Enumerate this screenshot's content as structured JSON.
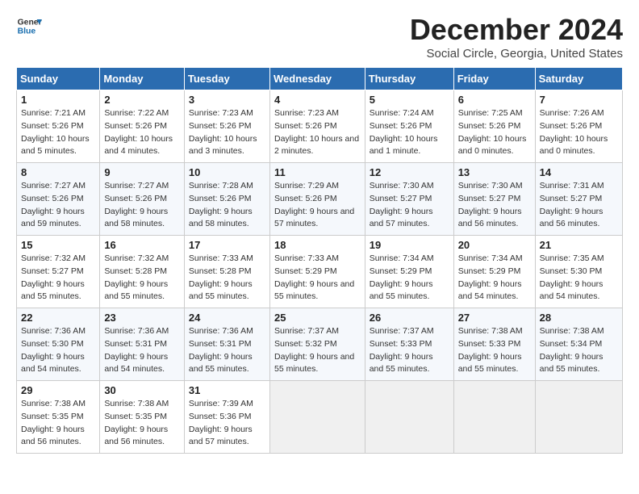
{
  "logo": {
    "text_general": "General",
    "text_blue": "Blue"
  },
  "title": "December 2024",
  "subtitle": "Social Circle, Georgia, United States",
  "days_of_week": [
    "Sunday",
    "Monday",
    "Tuesday",
    "Wednesday",
    "Thursday",
    "Friday",
    "Saturday"
  ],
  "weeks": [
    [
      {
        "num": "1",
        "sunrise": "7:21 AM",
        "sunset": "5:26 PM",
        "daylight": "10 hours and 5 minutes."
      },
      {
        "num": "2",
        "sunrise": "7:22 AM",
        "sunset": "5:26 PM",
        "daylight": "10 hours and 4 minutes."
      },
      {
        "num": "3",
        "sunrise": "7:23 AM",
        "sunset": "5:26 PM",
        "daylight": "10 hours and 3 minutes."
      },
      {
        "num": "4",
        "sunrise": "7:23 AM",
        "sunset": "5:26 PM",
        "daylight": "10 hours and 2 minutes."
      },
      {
        "num": "5",
        "sunrise": "7:24 AM",
        "sunset": "5:26 PM",
        "daylight": "10 hours and 1 minute."
      },
      {
        "num": "6",
        "sunrise": "7:25 AM",
        "sunset": "5:26 PM",
        "daylight": "10 hours and 0 minutes."
      },
      {
        "num": "7",
        "sunrise": "7:26 AM",
        "sunset": "5:26 PM",
        "daylight": "10 hours and 0 minutes."
      }
    ],
    [
      {
        "num": "8",
        "sunrise": "7:27 AM",
        "sunset": "5:26 PM",
        "daylight": "9 hours and 59 minutes."
      },
      {
        "num": "9",
        "sunrise": "7:27 AM",
        "sunset": "5:26 PM",
        "daylight": "9 hours and 58 minutes."
      },
      {
        "num": "10",
        "sunrise": "7:28 AM",
        "sunset": "5:26 PM",
        "daylight": "9 hours and 58 minutes."
      },
      {
        "num": "11",
        "sunrise": "7:29 AM",
        "sunset": "5:26 PM",
        "daylight": "9 hours and 57 minutes."
      },
      {
        "num": "12",
        "sunrise": "7:30 AM",
        "sunset": "5:27 PM",
        "daylight": "9 hours and 57 minutes."
      },
      {
        "num": "13",
        "sunrise": "7:30 AM",
        "sunset": "5:27 PM",
        "daylight": "9 hours and 56 minutes."
      },
      {
        "num": "14",
        "sunrise": "7:31 AM",
        "sunset": "5:27 PM",
        "daylight": "9 hours and 56 minutes."
      }
    ],
    [
      {
        "num": "15",
        "sunrise": "7:32 AM",
        "sunset": "5:27 PM",
        "daylight": "9 hours and 55 minutes."
      },
      {
        "num": "16",
        "sunrise": "7:32 AM",
        "sunset": "5:28 PM",
        "daylight": "9 hours and 55 minutes."
      },
      {
        "num": "17",
        "sunrise": "7:33 AM",
        "sunset": "5:28 PM",
        "daylight": "9 hours and 55 minutes."
      },
      {
        "num": "18",
        "sunrise": "7:33 AM",
        "sunset": "5:29 PM",
        "daylight": "9 hours and 55 minutes."
      },
      {
        "num": "19",
        "sunrise": "7:34 AM",
        "sunset": "5:29 PM",
        "daylight": "9 hours and 55 minutes."
      },
      {
        "num": "20",
        "sunrise": "7:34 AM",
        "sunset": "5:29 PM",
        "daylight": "9 hours and 54 minutes."
      },
      {
        "num": "21",
        "sunrise": "7:35 AM",
        "sunset": "5:30 PM",
        "daylight": "9 hours and 54 minutes."
      }
    ],
    [
      {
        "num": "22",
        "sunrise": "7:36 AM",
        "sunset": "5:30 PM",
        "daylight": "9 hours and 54 minutes."
      },
      {
        "num": "23",
        "sunrise": "7:36 AM",
        "sunset": "5:31 PM",
        "daylight": "9 hours and 54 minutes."
      },
      {
        "num": "24",
        "sunrise": "7:36 AM",
        "sunset": "5:31 PM",
        "daylight": "9 hours and 55 minutes."
      },
      {
        "num": "25",
        "sunrise": "7:37 AM",
        "sunset": "5:32 PM",
        "daylight": "9 hours and 55 minutes."
      },
      {
        "num": "26",
        "sunrise": "7:37 AM",
        "sunset": "5:33 PM",
        "daylight": "9 hours and 55 minutes."
      },
      {
        "num": "27",
        "sunrise": "7:38 AM",
        "sunset": "5:33 PM",
        "daylight": "9 hours and 55 minutes."
      },
      {
        "num": "28",
        "sunrise": "7:38 AM",
        "sunset": "5:34 PM",
        "daylight": "9 hours and 55 minutes."
      }
    ],
    [
      {
        "num": "29",
        "sunrise": "7:38 AM",
        "sunset": "5:35 PM",
        "daylight": "9 hours and 56 minutes."
      },
      {
        "num": "30",
        "sunrise": "7:38 AM",
        "sunset": "5:35 PM",
        "daylight": "9 hours and 56 minutes."
      },
      {
        "num": "31",
        "sunrise": "7:39 AM",
        "sunset": "5:36 PM",
        "daylight": "9 hours and 57 minutes."
      },
      null,
      null,
      null,
      null
    ]
  ]
}
